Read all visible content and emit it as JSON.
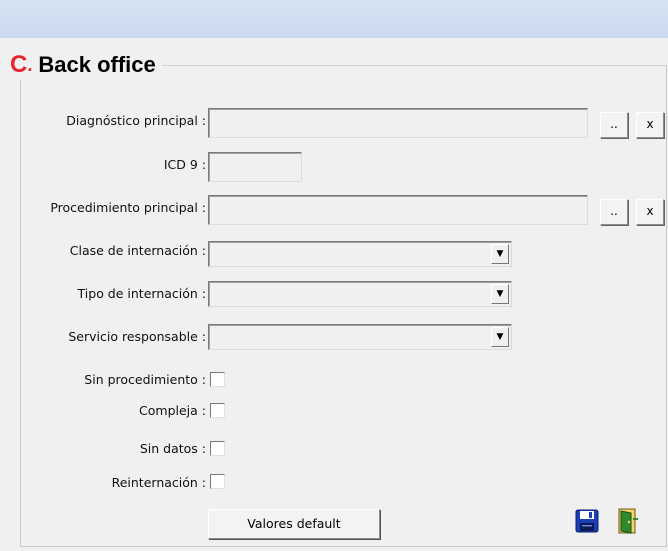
{
  "section": {
    "marker": "C",
    "marker_dot": ".",
    "title": "Back office"
  },
  "fields": {
    "diagnostico": {
      "label": "Diagnóstico principal :",
      "value": ""
    },
    "icd9": {
      "label": "ICD 9 :",
      "value": ""
    },
    "procedimiento": {
      "label": "Procedimiento principal :",
      "value": ""
    },
    "clase_internacion": {
      "label": "Clase de internación :",
      "value": ""
    },
    "tipo_internacion": {
      "label": "Tipo de internación :",
      "value": ""
    },
    "servicio_responsable": {
      "label": "Servicio responsable :",
      "value": ""
    }
  },
  "checkboxes": {
    "sin_procedimiento": {
      "label": "Sin procedimiento :",
      "checked": false
    },
    "compleja": {
      "label": "Compleja :",
      "checked": false
    },
    "sin_datos": {
      "label": "Sin datos :",
      "checked": false
    },
    "reinternacion": {
      "label": "Reinternación :",
      "checked": false
    }
  },
  "buttons": {
    "browse_label": "..",
    "clear_label": "x",
    "valores_default": "Valores default",
    "save_icon": "floppy-disk-icon",
    "exit_icon": "exit-door-icon"
  },
  "colors": {
    "accent_red": "#e8242d",
    "save_blue": "#1a3fb5",
    "exit_green": "#2f8a2f"
  }
}
